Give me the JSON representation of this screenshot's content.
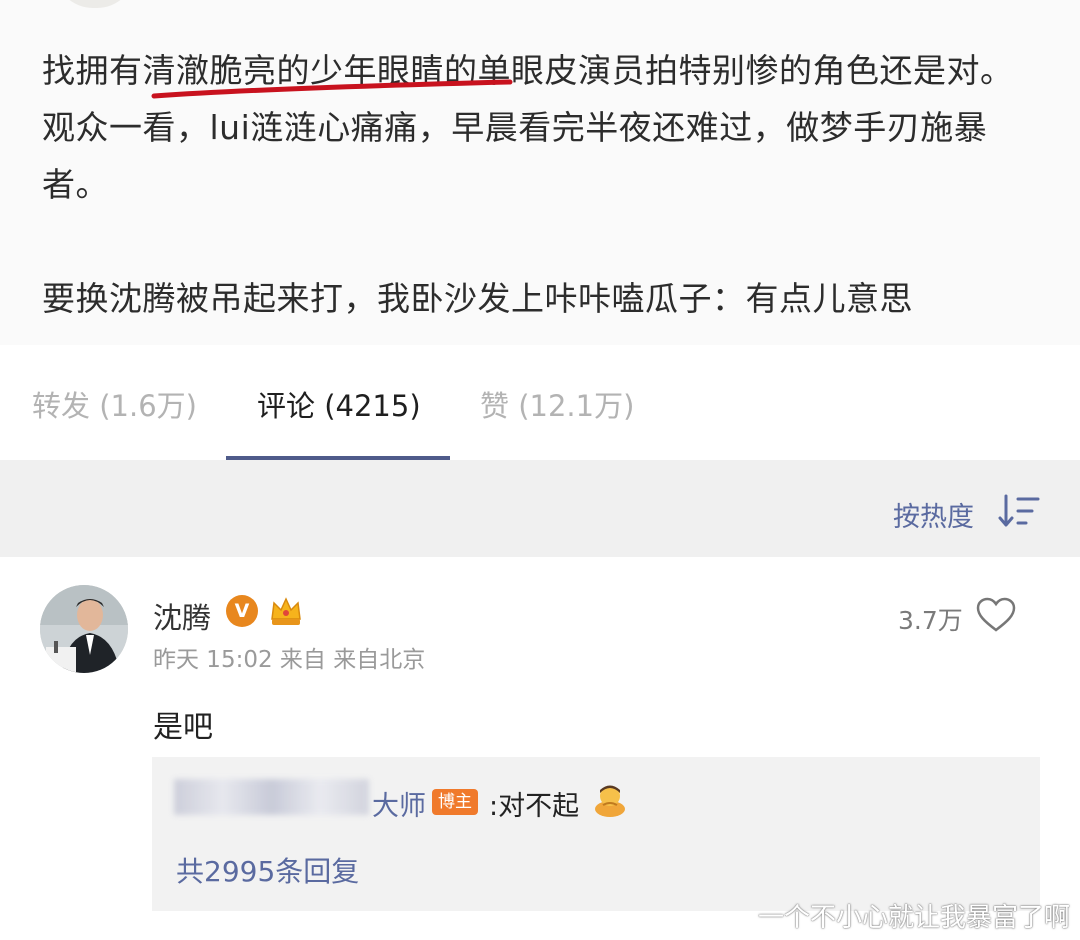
{
  "post": {
    "paragraph1_line1": "找拥有清澈脆亮的少年眼睛的单眼皮演员拍特别惨的角色还是对。",
    "paragraph1_line2": "观众一看，lui涟涟心痛痛，早晨看完半夜还难过，做梦手刃施暴",
    "paragraph1_line3": "者。",
    "paragraph2": "要换沈腾被吊起来打，我卧沙发上咔咔嗑瓜子：有点儿意思"
  },
  "tabs": {
    "repost": "转发 (1.6万)",
    "comments": "评论 (4215)",
    "likes": "赞 (12.1万)"
  },
  "sort": {
    "label": "按热度"
  },
  "comment": {
    "author": "沈腾",
    "vip_badge": "V",
    "meta": "昨天 15:02 来自 来自北京",
    "likes": "3.7万",
    "text": "是吧",
    "reply": {
      "name_tail": "大师",
      "badge": "博主",
      "text": ":对不起",
      "count": "共2995条回复"
    }
  },
  "watermark": "一个不小心就让我暴富了啊",
  "colors": {
    "accent_blue": "#5a6aa0",
    "tab_indicator": "#4f5b8a",
    "underline_red": "#c8121e",
    "badge_orange": "#f07a2c"
  }
}
